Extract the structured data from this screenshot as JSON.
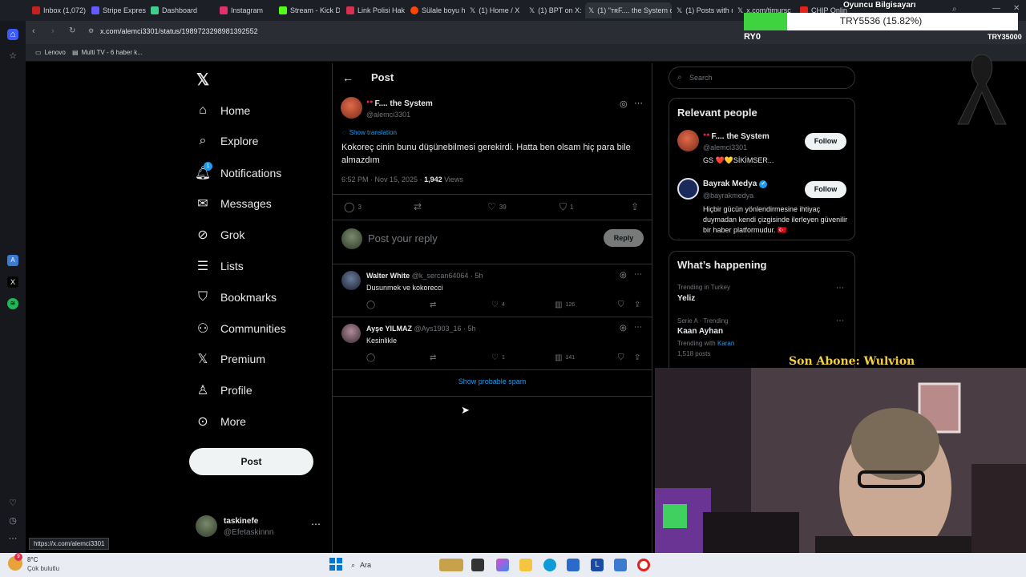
{
  "browser": {
    "tabs": [
      {
        "label": "Inbox (1,072) -",
        "color": "#c5221f"
      },
      {
        "label": "Stripe Express",
        "color": "#635bff"
      },
      {
        "label": "Dashboard",
        "color": "#3ecf8e"
      },
      {
        "label": "Instagram",
        "color": "#e1306c"
      },
      {
        "label": "Stream - Kick D",
        "color": "#53fc18"
      },
      {
        "label": "Link Polisi Hak",
        "color": "#d9304f"
      },
      {
        "label": "Sülale boyu ha",
        "color": "#ff4500"
      },
      {
        "label": "(1) Home / X",
        "color": "#ffffff"
      },
      {
        "label": "(1) BPT on X: \"I",
        "color": "#ffffff"
      },
      {
        "label": "(1) \"ᴛʀF.... the System o",
        "color": "#ffffff"
      },
      {
        "label": "(1) Posts with r",
        "color": "#ffffff"
      },
      {
        "label": "x.com/timursc",
        "color": "#ffffff"
      },
      {
        "label": "CHIP Onlin",
        "color": "#e2231a"
      }
    ],
    "url": "x.com/alemci3301/status/1989723298981392552",
    "bookmarks": [
      "Lenovo",
      "Multi TV - 6 haber k..."
    ],
    "status_url": "https://x.com/alemci3301"
  },
  "nav": {
    "items": [
      "Home",
      "Explore",
      "Notifications",
      "Messages",
      "Grok",
      "Lists",
      "Bookmarks",
      "Communities",
      "Premium",
      "Profile",
      "More"
    ],
    "notification_badge": "1",
    "post_button": "Post",
    "account": {
      "name": "taskinefe",
      "handle": "@Efetaskinnn"
    }
  },
  "post": {
    "header": "Post",
    "author_name": "F.... the System",
    "author_handle": "@alemci3301",
    "show_translation": "Show translation",
    "text": "Kokoreç cinin bunu düşünebilmesi gerekirdi. Hatta ben olsam hiç para bile almazdım",
    "time": "6:52 PM · Nov 15, 2025 · ",
    "views_count": "1,942",
    "views_label": " Views",
    "replies": "3",
    "likes": "39",
    "bookmarks": "1",
    "reply_placeholder": "Post your reply",
    "reply_button": "Reply"
  },
  "replies": [
    {
      "name": "Walter White",
      "meta": "@k_sercan64064 · 5h",
      "text": "Dusunmek ve kokorecci",
      "likes": "4",
      "views": "126"
    },
    {
      "name": "Ayşe YILMAZ",
      "meta": "@Ays1903_16 · 5h",
      "text": "Kesinlikle",
      "likes": "1",
      "views": "141"
    }
  ],
  "spam_link": "Show probable spam",
  "sidebar": {
    "search_placeholder": "Search",
    "relevant_title": "Relevant people",
    "people": [
      {
        "name": "F.... the System",
        "handle": "@alemci3301",
        "bio": "GS ❤️💛SİKİMSER...",
        "follow": "Follow"
      },
      {
        "name": "Bayrak Medya",
        "handle": "@bayrakmedya",
        "bio": "Hiçbir gücün yönlendirmesine ihtiyaç duymadan kendi çizgisinde ilerleyen güvenilir bir haber platformudur. 🇹🇷",
        "follow": "Follow"
      }
    ],
    "happening_title": "What’s happening",
    "trends": [
      {
        "context": "Trending in Turkey",
        "name": "Yeliz"
      },
      {
        "context": "Serie A · Trending",
        "name": "Kaan Ayhan",
        "with_label": "Trending with ",
        "with_link": "Karan",
        "posts": "1,518 posts"
      }
    ]
  },
  "overlay": {
    "viewer_label": "Oyuncu Bilgisayarı",
    "goal_text": "TRY5536 (15.82%)",
    "goal_progress": 0.1582,
    "goal_start": "RY0",
    "goal_end": "TRY35000",
    "subscriber": "Son Abone: Wulvion"
  },
  "taskbar": {
    "weather_temp": "8°C",
    "weather_desc": "Çok bulutlu",
    "search": "Ara"
  },
  "colors": {
    "accent": "#1d9bf0",
    "verified": "#1d9bf0",
    "like": "#f91880"
  }
}
